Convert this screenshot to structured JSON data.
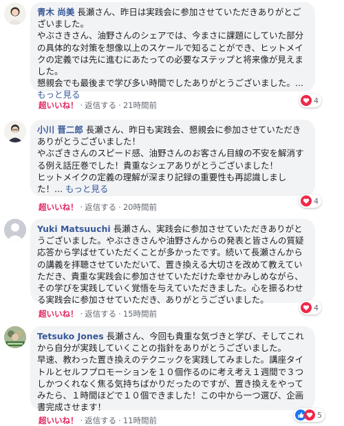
{
  "comments": [
    {
      "author": "青木 尚美",
      "text": "長瀬さん、昨日は実践会に参加させていただきありがとございました。\nやぶさきさん、油野さんのシェアでは、今まさに課題にしていた部分の具体的な対策を想像以上のスケールで知ることができ、ヒットメイクの定義では先に進むにあたっての必要なステップと将来像が見えました。\n懇親会でも最後まで学び多い時間でしたありがとうございました。...",
      "more": "もっと見る",
      "like": "超いいね！",
      "reply": "返信する",
      "time": "21時間前",
      "reaction_count": "4",
      "reaction_icons": [
        "love-icon"
      ]
    },
    {
      "author": "小川 晋二郎",
      "text": "長瀬さん、昨日も実践会、懇親会に参加させていただきありがとうございました！\nやぶざきさんのスピード感、油野さんのお客さん目線の不安を解消する例え話圧巻でした！貴重なシェアありがとうございました！\nヒットメイクの定義の理解が深まり記録の重要性も再認識しました！...",
      "more": "もっと見る",
      "like": "超いいね！",
      "reply": "返信する",
      "time": "20時間前",
      "reaction_count": "4",
      "reaction_icons": [
        "love-icon"
      ]
    },
    {
      "author": "Yuki Matsuuchi",
      "text": "長瀬さん、実践会に参加させていただきありがとうございました。やぶさきさんや油野さんからの発表と皆さんの質疑応答から学ばせていただくことが多かったです。続いて長瀬さんからの講義を拝聴させていただいて、置き換える大切さを改めて教えていただき、貴重な実践会に参加させていただけた幸せかみしめながら、その学びを実践していく覚悟を与えていただきました。心を振るわせる実践会に参加させていただき、ありがとうございました。",
      "more": "",
      "like": "超いいね！",
      "reply": "返信する",
      "time": "15時間前",
      "reaction_count": "4",
      "reaction_icons": [
        "love-icon"
      ]
    },
    {
      "author": "Tetsuko Jones",
      "text": "長瀬さん、今回も貴重な気づきと学び、そしてこれから自分が実践していくことの指針をありがとうございました。\n早速、教わった置き換えのテクニックを実践してみました。講座タイトルとセルフプロモーションを１０個作るのに考え考え１週間で３つしかつくれなく焦る気持ちばかりだったのですが、置き換えをやってみたら、１時間ほどで１０個できました！この中から一つ選び、企画書完成させます！",
      "more": "",
      "like": "超いいね！",
      "reply": "返信する",
      "time": "11時間前",
      "reaction_count": "5",
      "reaction_icons": [
        "like-icon",
        "love-icon"
      ]
    }
  ]
}
